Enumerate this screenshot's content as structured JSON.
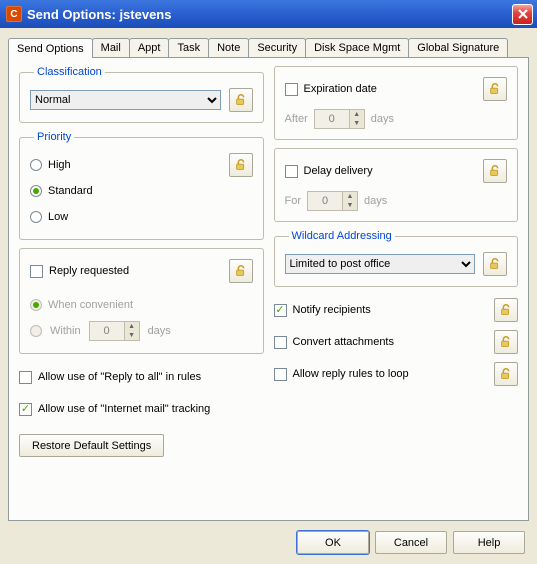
{
  "window": {
    "title": "Send Options:  jstevens"
  },
  "tabs": [
    {
      "label": "Send Options",
      "active": true
    },
    {
      "label": "Mail"
    },
    {
      "label": "Appt"
    },
    {
      "label": "Task"
    },
    {
      "label": "Note"
    },
    {
      "label": "Security"
    },
    {
      "label": "Disk Space Mgmt"
    },
    {
      "label": "Global Signature"
    }
  ],
  "classification": {
    "legend": "Classification",
    "value": "Normal"
  },
  "priority": {
    "legend": "Priority",
    "high": "High",
    "standard": "Standard",
    "low": "Low",
    "selected": "standard"
  },
  "reply": {
    "label": "Reply requested",
    "checked": false,
    "when_convenient": "When convenient",
    "within": "Within",
    "withinValue": "0",
    "daysLabel": "days"
  },
  "allow_reply_to_all": {
    "label": "Allow use of  \"Reply to all\" in rules",
    "checked": false
  },
  "allow_internet_mail": {
    "label": "Allow use of  \"Internet mail\" tracking",
    "checked": true
  },
  "restore_defaults": "Restore Default Settings",
  "expiration": {
    "label": "Expiration date",
    "checked": false,
    "after": "After",
    "value": "0",
    "daysLabel": "days"
  },
  "delay": {
    "label": "Delay delivery",
    "checked": false,
    "for": "For",
    "value": "0",
    "daysLabel": "days"
  },
  "wildcard": {
    "legend": "Wildcard Addressing",
    "value": "Limited to post office"
  },
  "notify": {
    "label": "Notify recipients",
    "checked": true
  },
  "convert_attachments": {
    "label": "Convert attachments",
    "checked": false
  },
  "allow_reply_loop": {
    "label": "Allow reply rules to loop",
    "checked": false
  },
  "buttons": {
    "ok": "OK",
    "cancel": "Cancel",
    "help": "Help"
  }
}
